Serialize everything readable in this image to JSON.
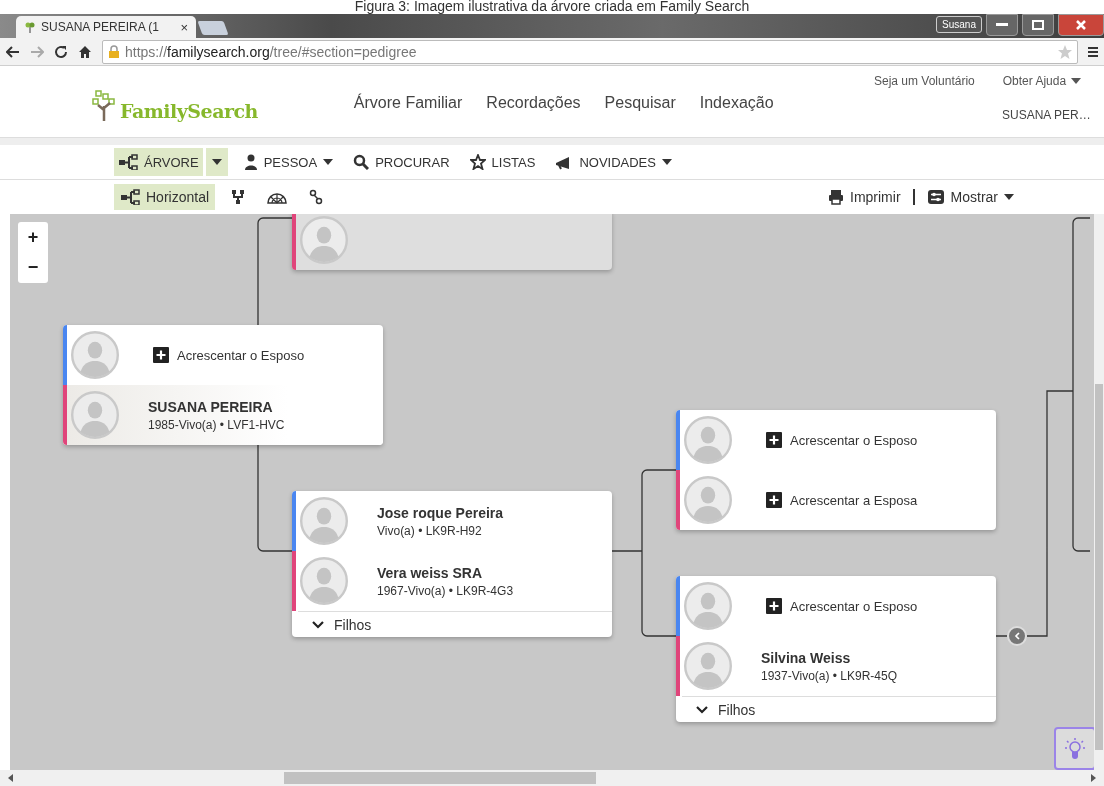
{
  "caption": "Figura 3: Imagem ilustrativa da árvore criada em Family Search",
  "browser": {
    "tab_title": "SUSANA PEREIRA (1",
    "tab_close": "×",
    "profile": "Susana",
    "url_scheme": "https://",
    "url_host": "familysearch.org",
    "url_path": "/tree/#section=pedigree"
  },
  "site": {
    "logo": "FamilySearch",
    "top_links": [
      {
        "label": "Seja um Voluntário",
        "dropdown": false
      },
      {
        "label": "Obter Ajuda",
        "dropdown": true
      }
    ],
    "nav": [
      "Árvore Familiar",
      "Recordações",
      "Pesquisar",
      "Indexação"
    ],
    "user": "SUSANA PER…"
  },
  "toolbar": [
    {
      "kind": "tree",
      "label": "ÁRVORE",
      "selected": true,
      "dropdown": true
    },
    {
      "kind": "person",
      "label": "PESSOA",
      "selected": false,
      "dropdown": true
    },
    {
      "kind": "search",
      "label": "PROCURAR",
      "selected": false,
      "dropdown": false
    },
    {
      "kind": "star",
      "label": "LISTAS",
      "selected": false,
      "dropdown": false
    },
    {
      "kind": "megaphone",
      "label": "NOVIDADES",
      "selected": false,
      "dropdown": true
    }
  ],
  "views": [
    {
      "kind": "tree",
      "label": "Horizontal",
      "selected": true
    },
    {
      "kind": "fork",
      "selected": false
    },
    {
      "kind": "fan",
      "selected": false
    },
    {
      "kind": "pins",
      "selected": false
    }
  ],
  "actions": [
    {
      "kind": "print",
      "label": "Imprimir",
      "dropdown": false
    },
    {
      "kind": "toggles",
      "label": "Mostrar",
      "dropdown": true
    }
  ],
  "zoom": {
    "in": "+",
    "out": "−"
  },
  "cards": [
    {
      "selected": false,
      "dimmed": true,
      "rows": [
        {
          "kind": "empty",
          "color": "#e0457b"
        }
      ]
    },
    {
      "selected": true,
      "dimmed": false,
      "rows": [
        {
          "kind": "add",
          "color": "#4a86f0",
          "label": "Acrescentar o Esposo"
        },
        {
          "kind": "person",
          "color": "#e0457b",
          "name": "SUSANA PEREIRA",
          "details": "1985-Vivo(a) • LVF1-HVC"
        }
      ]
    },
    {
      "selected": false,
      "dimmed": false,
      "children_toggle": "Filhos",
      "rows": [
        {
          "kind": "person",
          "color": "#4a86f0",
          "name": "Jose roque Pereira",
          "details": "Vivo(a) • LK9R-H92"
        },
        {
          "kind": "person",
          "color": "#e0457b",
          "name": "Vera weiss SRA",
          "details": "1967-Vivo(a) • LK9R-4G3"
        }
      ]
    },
    {
      "selected": false,
      "dimmed": false,
      "rows": [
        {
          "kind": "add",
          "color": "#4a86f0",
          "label": "Acrescentar o Esposo"
        },
        {
          "kind": "add",
          "color": "#e0457b",
          "label": "Acrescentar a Esposa"
        }
      ]
    },
    {
      "selected": false,
      "dimmed": false,
      "children_toggle": "Filhos",
      "rows": [
        {
          "kind": "add",
          "color": "#4a86f0",
          "label": "Acrescentar o Esposo"
        },
        {
          "kind": "person",
          "color": "#e0457b",
          "name": "Silvina Weiss",
          "details": "1937-Vivo(a) • LK9R-45Q"
        }
      ]
    }
  ]
}
